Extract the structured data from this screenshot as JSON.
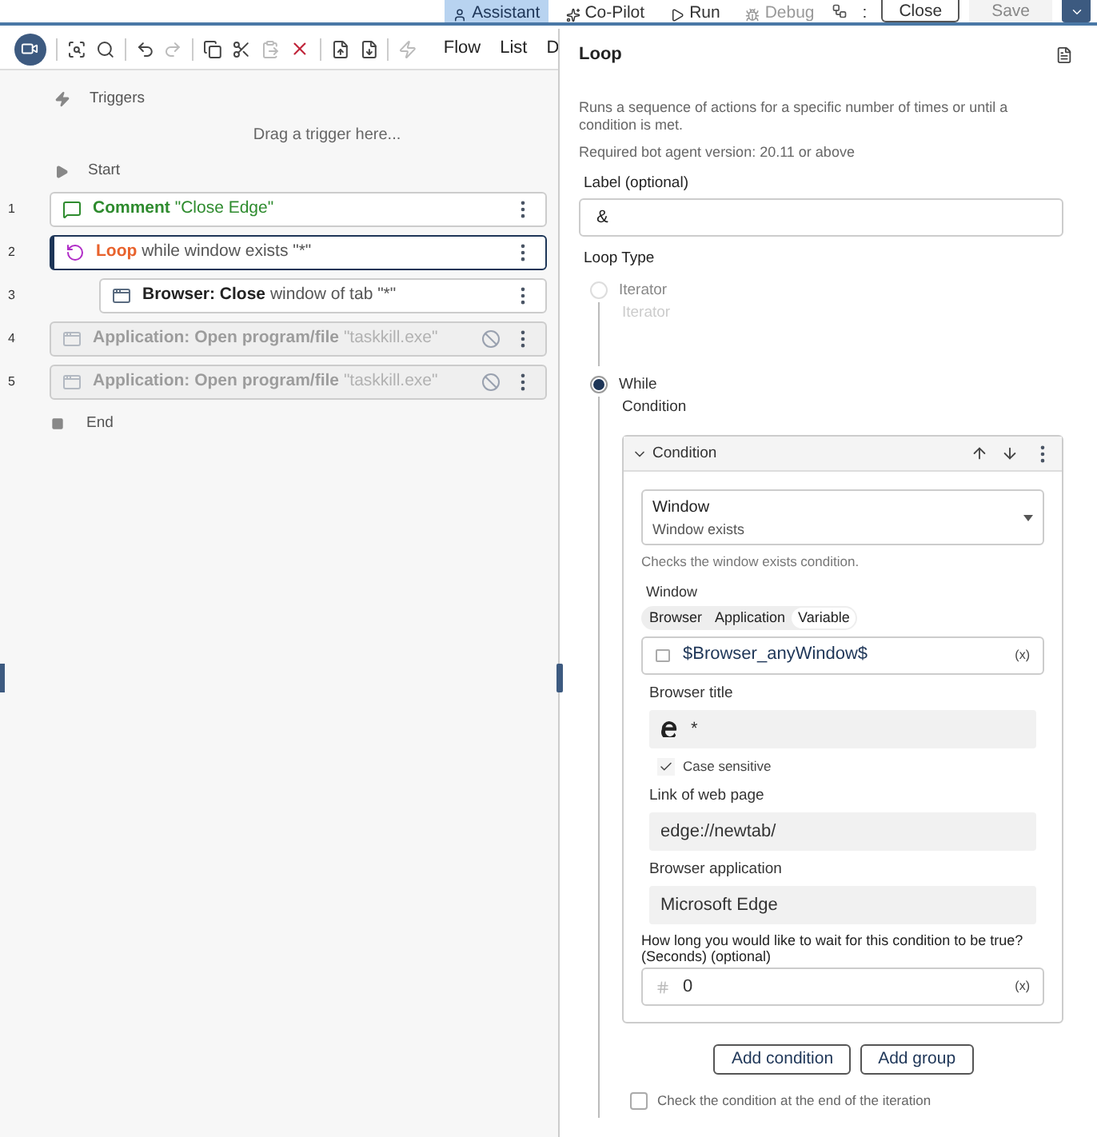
{
  "top_bar": {
    "buttons": [
      {
        "label": "Assistant",
        "selected": true,
        "disabled": false
      },
      {
        "label": "Co-Pilot",
        "selected": false,
        "disabled": false
      },
      {
        "label": "Run",
        "selected": false,
        "disabled": false
      },
      {
        "label": "Debug",
        "selected": false,
        "disabled": true
      }
    ],
    "more": ":",
    "close": "Close",
    "save": {
      "label": "Save",
      "disabled": true
    }
  },
  "toolbar": {
    "tabs": [
      "Flow",
      "List",
      "D"
    ]
  },
  "flow": {
    "triggers": "Triggers",
    "trigger_hint": "Drag a trigger here...",
    "start": "Start",
    "end": "End",
    "steps": [
      {
        "number": "1",
        "kind": "comment",
        "title": "Comment",
        "detail": "\"Close Edge\"",
        "disabled": false,
        "selected": false
      },
      {
        "number": "2",
        "kind": "loop",
        "title": "Loop",
        "detail": "while window exists \"*\"",
        "disabled": false,
        "selected": true,
        "children": [
          {
            "number": "3",
            "kind": "browser",
            "title": "Browser: Close",
            "detail": "window of tab \"*\"",
            "disabled": false,
            "selected": false
          }
        ]
      },
      {
        "number": "4",
        "kind": "application",
        "title": "Application: Open program/file",
        "detail": "\"taskkill.exe\"",
        "disabled": true,
        "selected": false
      },
      {
        "number": "5",
        "kind": "application",
        "title": "Application: Open program/file",
        "detail": "\"taskkill.exe\"",
        "disabled": true,
        "selected": false
      }
    ]
  },
  "panel": {
    "title": "Loop",
    "description": "Runs a sequence of actions for a specific number of times or until a condition is met.",
    "version": "Required bot agent version: 20.11 or above",
    "label_field": {
      "label": "Label (optional)",
      "value": "&"
    },
    "loop_type": {
      "label": "Loop Type",
      "options": [
        {
          "label": "Iterator",
          "selected": false,
          "placeholder": "Iterator"
        },
        {
          "label": "While",
          "selected": true,
          "sub_label": "Condition"
        }
      ]
    },
    "condition": {
      "header": "Condition",
      "type_select": {
        "label": "Window",
        "value": "Window exists"
      },
      "hint": "Checks the window exists condition.",
      "window_label": "Window",
      "segments": [
        {
          "label": "Browser",
          "selected": false
        },
        {
          "label": "Application",
          "selected": false
        },
        {
          "label": "Variable",
          "selected": true
        }
      ],
      "variable": {
        "value": "$Browser_anyWindow$",
        "suffix": "(x)"
      },
      "browser_title": {
        "label": "Browser title",
        "value": "*"
      },
      "case_sensitive": {
        "label": "Case sensitive",
        "checked": true
      },
      "link": {
        "label": "Link of web page",
        "value": "edge://newtab/"
      },
      "browser_app": {
        "label": "Browser application",
        "value": "Microsoft Edge"
      },
      "wait": {
        "label": "How long you would like to wait for this condition to be true?(Seconds) (optional)",
        "value": "0",
        "suffix": "(x)"
      }
    },
    "buttons": [
      "Add condition",
      "Add group"
    ],
    "end_check": {
      "label": "Check the condition at the end of the iteration",
      "checked": false
    }
  }
}
